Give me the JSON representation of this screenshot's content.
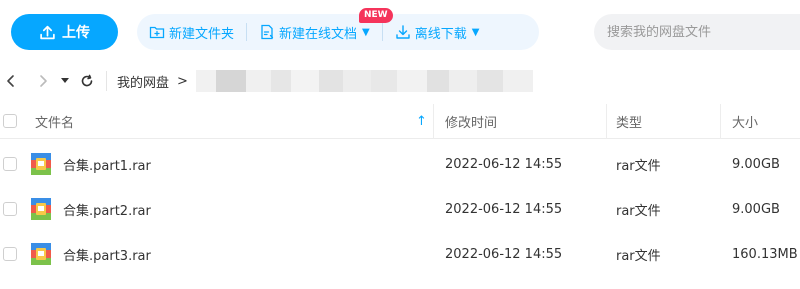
{
  "toolbar": {
    "upload_label": "上传",
    "new_folder_label": "新建文件夹",
    "new_online_doc_label": "新建在线文档",
    "new_badge": "NEW",
    "offline_download_label": "离线下载",
    "accent_color": "#06a7ff"
  },
  "search": {
    "placeholder": "搜索我的网盘文件"
  },
  "breadcrumb": {
    "root": "我的网盘",
    "separator": ">"
  },
  "table": {
    "headers": {
      "name": "文件名",
      "modified": "修改时间",
      "type": "类型",
      "size": "大小"
    },
    "rows": [
      {
        "name": "合集.part1.rar",
        "modified": "2022-06-12 14:55",
        "type": "rar文件",
        "size": "9.00GB",
        "icon": "rar-archive-icon"
      },
      {
        "name": "合集.part2.rar",
        "modified": "2022-06-12 14:55",
        "type": "rar文件",
        "size": "9.00GB",
        "icon": "rar-archive-icon"
      },
      {
        "name": "合集.part3.rar",
        "modified": "2022-06-12 14:55",
        "type": "rar文件",
        "size": "160.13MB",
        "icon": "rar-archive-icon"
      }
    ]
  }
}
